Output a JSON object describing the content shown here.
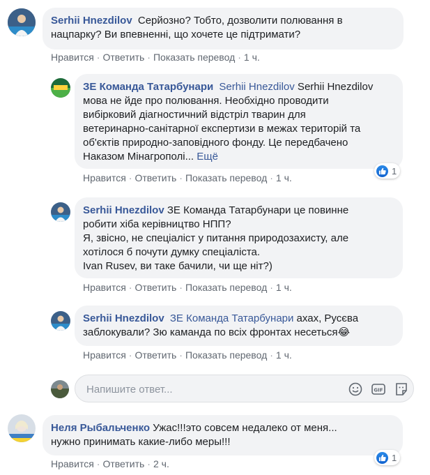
{
  "comments": [
    {
      "author": "Serhii Hnezdilov",
      "line1": "Серйозно? Тобто, дозволити полювання в",
      "line2": "нацпарку? Ви впевненні, що хочете це підтримати?",
      "time": "1 ч."
    },
    {
      "author": "ЗЕ Команда Татарбунари",
      "mention": "Serhii Hnezdilov",
      "line1_tail": " Serhii Hnezdilov",
      "line2": "мова не йде про полювання. Необхідно проводити",
      "line3": "вибірковий діагностичний відстріл тварин для",
      "line4": "ветеринарно-санітарної експертизи в межах територій та",
      "line5": "об'єктів природно-заповідного фонду. Це передбачено",
      "line6": "Наказом Мінагрополі...",
      "more": "Ещё",
      "reactions": "1",
      "time": "1 ч."
    },
    {
      "author": "Serhii Hnezdilov",
      "line1_tail": " ЗЕ Команда Татарбунари це повинне",
      "line2": "робити хіба керівництво НПП?",
      "line3": "Я, звісно, не спеціаліст у питання природозахисту, але",
      "line4": "хотілося б почути думку спеціаліста.",
      "line5": "Ivan Rusev, ви таке бачили, чи ще ніт?)",
      "time": "1 ч."
    },
    {
      "author": "Serhii Hnezdilov",
      "mention": "ЗЕ Команда Татарбунари",
      "line1_tail": " ахах, Русєва",
      "line2": "заблокували? Зю каманда по всіх фронтах несеться",
      "emoji": "😂",
      "time": "1 ч."
    },
    {
      "author": "Неля Рыбальченко",
      "line1_tail": " Ужас!!!это совсем недалеко от меня...",
      "line2": "нужно принимать какие-либо меры!!!",
      "reactions": "1",
      "time": "2 ч."
    }
  ],
  "actions": {
    "like": "Нравится",
    "reply": "Ответить",
    "translate": "Показать перевод",
    "sep": "·"
  },
  "reply_box": {
    "placeholder": "Напишите ответ..."
  },
  "colors": {
    "link": "#385898",
    "bubble": "#f2f3f5",
    "meta": "#606770",
    "like_blue": "#1877f2"
  }
}
